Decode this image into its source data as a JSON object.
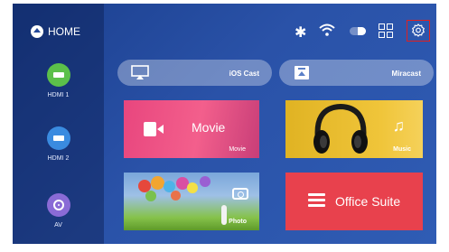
{
  "home": {
    "label": "HOME"
  },
  "sources": [
    {
      "label": "HDMI 1",
      "color": "#5cc04a",
      "icon": "hdmi-icon"
    },
    {
      "label": "HDMI 2",
      "color": "#3a8be0",
      "icon": "hdmi-icon"
    },
    {
      "label": "AV",
      "color": "#8a6bd6",
      "icon": "disc-icon"
    }
  ],
  "status_icons": [
    "bluetooth-icon",
    "wifi-icon",
    "battery-icon",
    "apps-grid-icon",
    "settings-gear-icon"
  ],
  "cast": {
    "ios_label": "iOS Cast",
    "miracast_label": "Miracast"
  },
  "tiles": {
    "movie_big_label": "Movie",
    "movie_small_label": "Movie",
    "music_label": "Music",
    "photo_label": "Photo",
    "office_label": "Office Suite"
  },
  "colors": {
    "background": "#2a52a8",
    "movie": "#ee4f84",
    "music": "#f0c53a",
    "office": "#e8414d",
    "highlight": "#e02020"
  }
}
